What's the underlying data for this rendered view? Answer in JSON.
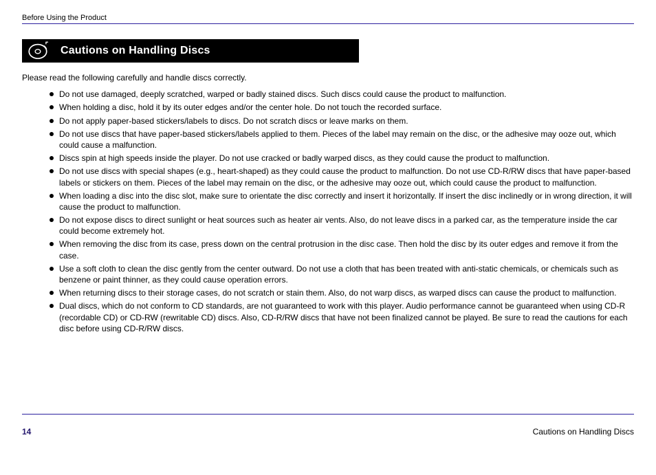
{
  "runningHead": "Before Using the Product",
  "sectionTitle": "Cautions on Handling Discs",
  "intro": "Please read the following carefully and handle discs correctly.",
  "cautions": [
    "Do not use damaged, deeply scratched, warped or badly stained discs. Such discs could cause the product to malfunction.",
    "When holding a disc, hold it by its outer edges and/or the center hole. Do not touch the recorded surface.",
    "Do not apply paper-based stickers/labels to discs. Do not scratch discs or leave marks on them.",
    "Do not use discs that have paper-based stickers/labels applied to them. Pieces of the label may remain on the disc, or the adhesive may ooze out, which could cause a malfunction.",
    "Discs spin at high speeds inside the player. Do not use cracked or badly warped discs, as they could cause the product to malfunction.",
    "Do not use discs with special shapes (e.g., heart-shaped) as they could cause the product to malfunction. Do not use CD-R/RW discs that have paper-based labels or stickers on them. Pieces of the label may remain on the disc, or the adhesive may ooze out, which could cause the product to malfunction.",
    "When loading a disc into the disc slot, make sure to orientate the disc correctly and insert it horizontally. If insert the disc inclinedly or in wrong direction, it will cause the product to malfunction.",
    "Do not expose discs to direct sunlight or heat sources such as heater air vents. Also, do not leave discs in a parked car, as the temperature inside the car could become extremely hot.",
    "When removing the disc from its case, press down on the central protrusion in the disc case. Then hold the disc by its outer edges and remove it from the case.",
    "Use a soft cloth to clean the disc gently from the center outward. Do not use a cloth that has been treated with anti-static chemicals, or chemicals such as benzene or paint thinner, as they could cause operation errors.",
    "When returning discs to their storage cases, do not scratch or stain them. Also, do not warp discs, as warped discs can cause the product to malfunction.",
    "Dual discs, which do not conform to CD standards, are not guaranteed to work with this player. Audio performance cannot be guaranteed when using CD-R (recordable CD) or CD-RW (rewritable CD) discs. Also, CD-R/RW discs that have not been finalized cannot be played. Be sure to read the cautions for each disc before using CD-R/RW discs."
  ],
  "footer": {
    "page": "14",
    "title": "Cautions on Handling Discs"
  }
}
